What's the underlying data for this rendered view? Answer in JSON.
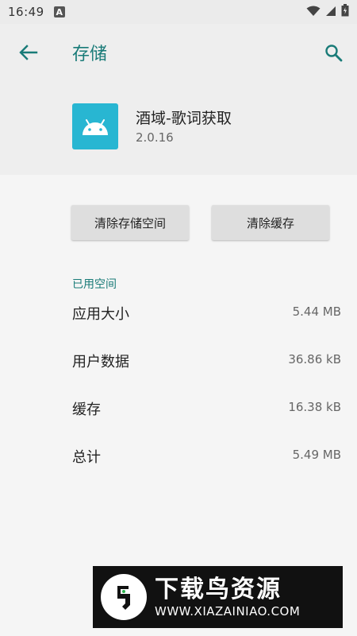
{
  "status_bar": {
    "time": "16:49",
    "notification_badge": "A",
    "icons": [
      "wifi-icon",
      "signal-icon",
      "battery-icon"
    ]
  },
  "header": {
    "title": "存储",
    "back_icon": "arrow-left-icon",
    "search_icon": "search-icon"
  },
  "app": {
    "name": "酒域-歌词获取",
    "version": "2.0.16",
    "icon": "android-icon",
    "icon_color": "#28b6d2"
  },
  "actions": {
    "clear_storage": "清除存储空间",
    "clear_cache": "清除缓存"
  },
  "usage": {
    "section_label": "已用空间",
    "rows": [
      {
        "label": "应用大小",
        "value": "5.44 MB"
      },
      {
        "label": "用户数据",
        "value": "36.86 kB"
      },
      {
        "label": "缓存",
        "value": "16.38 kB"
      },
      {
        "label": "总计",
        "value": "5.49 MB"
      }
    ]
  },
  "watermark": {
    "title": "下载鸟资源",
    "url": "WWW.XIAZAINIAO.COM"
  },
  "colors": {
    "accent": "#197b78",
    "background": "#f5f5f5",
    "header_bg": "#eeeeee",
    "button_bg": "#dedede"
  }
}
